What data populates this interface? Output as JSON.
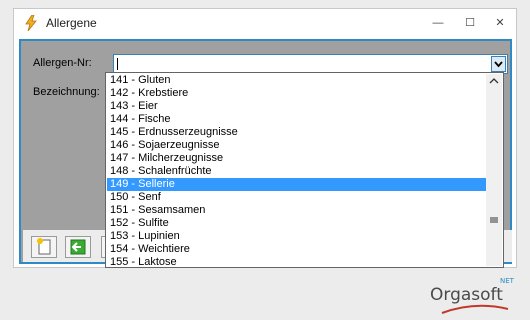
{
  "window": {
    "title": "Allergene",
    "icon": "lightning-icon",
    "controls": {
      "minimize": "—",
      "maximize": "☐",
      "close": "✕"
    }
  },
  "form": {
    "allergen_nr_label": "Allergen-Nr:",
    "allergen_nr_value": "",
    "bezeichnung_label": "Bezeichnung:"
  },
  "dropdown": {
    "items": [
      "141 - Gluten",
      "142 - Krebstiere",
      "143 - Eier",
      "144 - Fische",
      "145 - Erdnusserzeugnisse",
      "146 - Sojaerzeugnisse",
      "147 - Milcherzeugnisse",
      "148 - Schalenfrüchte",
      "149 - Sellerie",
      "150 - Senf",
      "151 - Sesamsamen",
      "152 - Sulfite",
      "153 - Lupinien",
      "154 - Weichtiere",
      "155 - Laktose"
    ],
    "selected_item": "149 - Sellerie"
  },
  "toolbar": {
    "buttons": [
      "new-document-icon",
      "back-arrow-icon",
      "forward-icon"
    ]
  },
  "brand": {
    "name": "Orgasoft",
    "suffix": "NET"
  },
  "colors": {
    "accent": "#2f89c5",
    "selection": "#3399ff",
    "panel": "#a0a0a0"
  }
}
